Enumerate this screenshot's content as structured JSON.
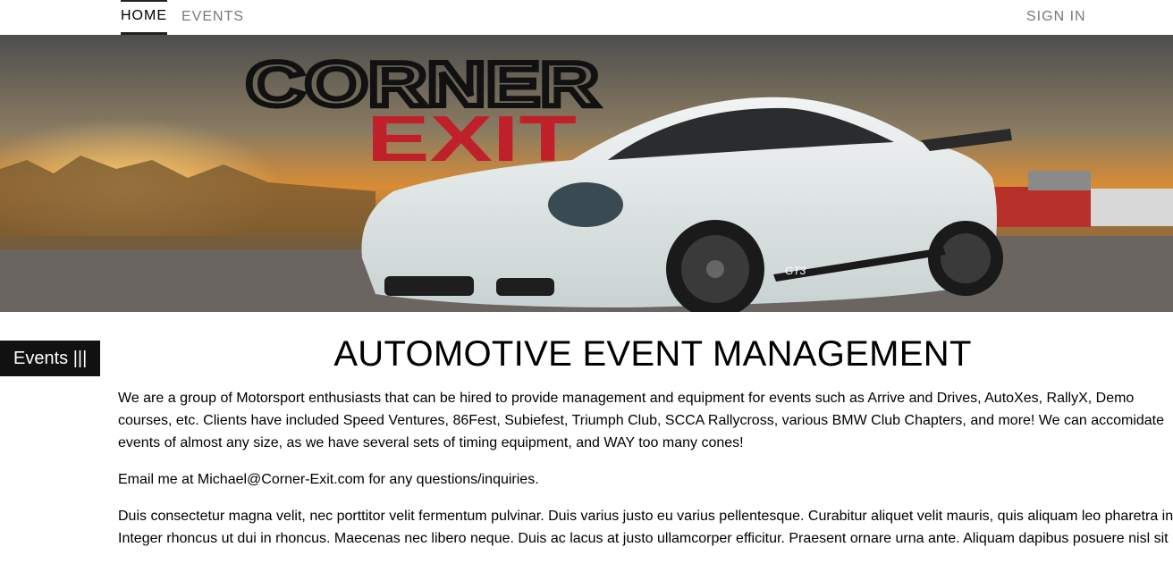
{
  "nav": {
    "home": "HOME",
    "events": "EVENTS",
    "signin": "SIGN IN"
  },
  "hero": {
    "logo_line1": "CORNER",
    "logo_line2": "EXIT",
    "car_badge": "GT3"
  },
  "sidebar": {
    "events_tab": "Events |||"
  },
  "main": {
    "title": "AUTOMOTIVE EVENT MANAGEMENT",
    "paragraphs": [
      "We are a group of Motorsport enthusiasts that can be hired to provide management and equipment for events such as Arrive and Drives, AutoXes, RallyX, Demo courses, etc. Clients have included Speed Ventures, 86Fest, Subiefest, Triumph Club, SCCA Rallycross, various BMW Club Chapters, and more! We can accomidate events of almost any size, as we have several sets of timing equipment, and WAY too many cones!",
      "Email me at Michael@Corner-Exit.com for any questions/inquiries.",
      "Duis consectetur magna velit, nec porttitor velit fermentum pulvinar. Duis varius justo eu varius pellentesque. Curabitur aliquet velit mauris, quis aliquam leo pharetra in. Integer rhoncus ut dui in rhoncus. Maecenas nec libero neque. Duis ac lacus at justo ullamcorper efficitur. Praesent ornare urna ante. Aliquam dapibus posuere nisl sit"
    ]
  },
  "colors": {
    "accent_red": "#c0202a",
    "nav_inactive": "#7a7a7a",
    "tab_bg": "#111111"
  }
}
